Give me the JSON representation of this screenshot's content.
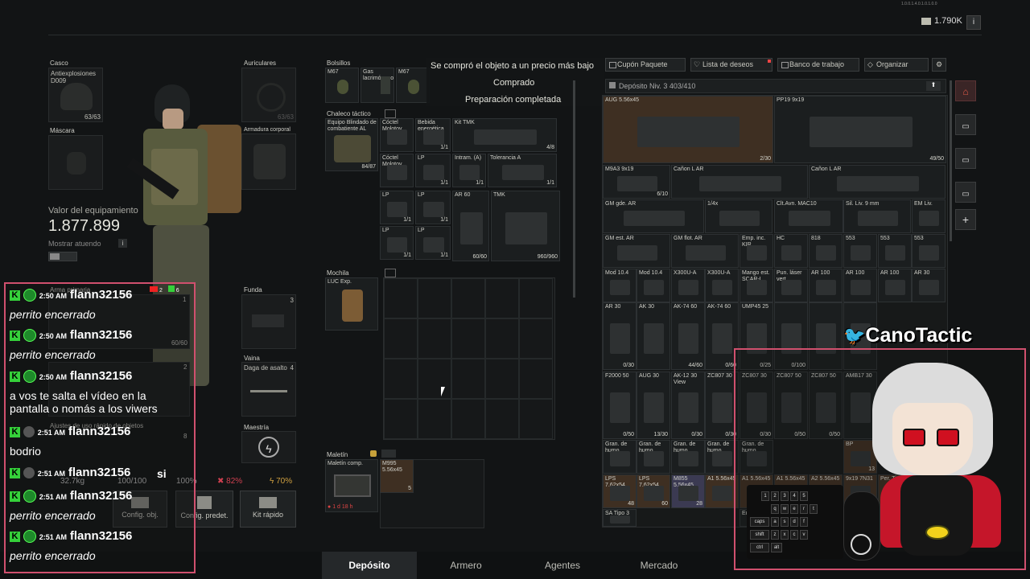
{
  "top_bar": {
    "version_text": "1.0.0.1.4.0.1.0.1.0.0",
    "currency_amount": "1.790K",
    "info_label": "i"
  },
  "notifications": [
    "Se compró el objeto a un precio más bajo",
    "Comprado",
    "Preparación completada"
  ],
  "equipment": {
    "casco_label": "Casco",
    "casco_item": "Antiexplosiones D009",
    "casco_count": "63/63",
    "mascara_label": "Máscara",
    "auriculares_label": "Auriculares",
    "armadura_label": "Armadura corporal",
    "valor_label": "Valor del equipamiento",
    "valor": "1.877.899",
    "mostrar_label": "Mostrar atuendo",
    "arma_primaria_label": "Arma primaria",
    "arma_count": "60/60",
    "funda_label": "Funda",
    "funda_count": "3",
    "vaina_label": "Vaina",
    "vaina_item": "Daga de asalto",
    "vaina_count": "4",
    "maestria_label": "Maestría",
    "ajustes_label": "Ajustes de uso rápido de objetos",
    "slot8_count": "8",
    "slot2_count": "2",
    "slot1_count": "1",
    "weight": "32.7kg",
    "hp": "100/100",
    "stat_100": "100%",
    "stat_82": "82%",
    "stat_70": "70%",
    "btn_config_obj": "Config. obj.",
    "btn_config_predet": "Config. predet.",
    "btn_kit_rapido": "Kit rápido"
  },
  "pockets": {
    "label": "Bolsillos",
    "items": [
      {
        "name": "M67",
        "count": ""
      },
      {
        "name": "Gas lacrimógeno",
        "count": ""
      },
      {
        "name": "M67",
        "count": ""
      }
    ]
  },
  "chaleco": {
    "label": "Chaleco táctico",
    "item": "Equipo Blindado de combatiente AL",
    "item_count": "84/87",
    "cells": [
      {
        "name": "Cóctel Molotov",
        "count": ""
      },
      {
        "name": "Bebida energética",
        "count": "1/1"
      },
      {
        "name": "Kit TMK",
        "count": "4/8"
      },
      {
        "name": "Cóctel Molotov",
        "count": ""
      },
      {
        "name": "LP",
        "count": "1/1"
      },
      {
        "name": "Intram. (A)",
        "count": "1/1"
      },
      {
        "name": "Tolerancia A",
        "count": "1/1"
      },
      {
        "name": "LP",
        "count": "1/1"
      },
      {
        "name": "LP",
        "count": "1/1"
      },
      {
        "name": "AR 60",
        "count": "60/60"
      },
      {
        "name": "TMK",
        "count": "960/960"
      },
      {
        "name": "LP",
        "count": "1/1"
      },
      {
        "name": "LP",
        "count": "1/1"
      },
      {
        "name": "LP",
        "count": "1/1"
      },
      {
        "name": "LP",
        "count": "1/1"
      }
    ]
  },
  "mochila": {
    "label": "Mochila",
    "item": "LUC Exp."
  },
  "maletin": {
    "label": "Maletín",
    "item": "Maletín comp.",
    "time": "1 d 18 h",
    "ammo_name": "M995 5.56x45",
    "ammo_count": "5"
  },
  "stash": {
    "tabs": [
      "Cupón Paquete",
      "Lista de deseos",
      "Banco de trabajo",
      "Organizar"
    ],
    "header": "Depósito Niv. 3  403/410",
    "items": [
      {
        "name": "AUG 5.56x45",
        "count": "2/30"
      },
      {
        "name": "PP19 9x19",
        "count": "49/50"
      },
      {
        "name": "M9A3 9x19",
        "count": "6/10"
      },
      {
        "name": "Cañon L AR",
        "count": ""
      },
      {
        "name": "Cañon L AR",
        "count": ""
      },
      {
        "name": "GM gde. AR",
        "count": ""
      },
      {
        "name": "1/4x",
        "count": ""
      },
      {
        "name": "Clt.Avn. MAC10",
        "count": ""
      },
      {
        "name": "Sil. Liv. 9 mm",
        "count": ""
      },
      {
        "name": "EM Liv.",
        "count": ""
      },
      {
        "name": "GM est. AR",
        "count": ""
      },
      {
        "name": "GM flot. AR",
        "count": ""
      },
      {
        "name": "Emp. inc. KIR",
        "count": ""
      },
      {
        "name": "HC",
        "count": ""
      },
      {
        "name": "818",
        "count": ""
      },
      {
        "name": "553",
        "count": ""
      },
      {
        "name": "553",
        "count": ""
      },
      {
        "name": "553",
        "count": ""
      },
      {
        "name": "Mod 10.4",
        "count": ""
      },
      {
        "name": "Mod 10.4",
        "count": ""
      },
      {
        "name": "X300U-A",
        "count": ""
      },
      {
        "name": "X300U-A",
        "count": ""
      },
      {
        "name": "Mango est. SCAR-L",
        "count": ""
      },
      {
        "name": "Pun. láser vert.",
        "count": ""
      },
      {
        "name": "AR 100",
        "count": ""
      },
      {
        "name": "AR 100",
        "count": ""
      },
      {
        "name": "AR 100",
        "count": ""
      },
      {
        "name": "AR 30",
        "count": ""
      },
      {
        "name": "AR 30",
        "count": "0/30"
      },
      {
        "name": "AK 30",
        "count": ""
      },
      {
        "name": "AK-74 60",
        "count": "44/60"
      },
      {
        "name": "AK-74 60",
        "count": "0/60"
      },
      {
        "name": "UMP45 25",
        "count": "0/25"
      },
      {
        "name": "",
        "count": "0/100"
      },
      {
        "name": "",
        "count": ""
      },
      {
        "name": "",
        "count": ""
      },
      {
        "name": "F2000 50",
        "count": "0/50"
      },
      {
        "name": "AUG 30",
        "count": "13/30"
      },
      {
        "name": "AK-12 30 View",
        "count": "0/30"
      },
      {
        "name": "ZC807 30",
        "count": "0/30"
      },
      {
        "name": "ZC807 30",
        "count": "0/30"
      },
      {
        "name": "ZC807 50",
        "count": "0/50"
      },
      {
        "name": "ZC807 50",
        "count": "0/50"
      },
      {
        "name": "AMB17 30",
        "count": ""
      },
      {
        "name": "Gran. de humo",
        "count": ""
      },
      {
        "name": "Gran. de humo",
        "count": ""
      },
      {
        "name": "Gran. de humo",
        "count": ""
      },
      {
        "name": "Gran. de humo",
        "count": ""
      },
      {
        "name": "Gran. de humo",
        "count": ""
      },
      {
        "name": "BP",
        "count": "13"
      },
      {
        "name": "LPS 7.62x54",
        "count": "48"
      },
      {
        "name": "LPS 7.62x54",
        "count": "60"
      },
      {
        "name": "M855 5.56x45",
        "count": "28"
      },
      {
        "name": "A1 5.56x45",
        "count": ""
      },
      {
        "name": "A1 5.56x45",
        "count": ""
      },
      {
        "name": "A1 5.56x45",
        "count": ""
      },
      {
        "name": "A2 5.56x45",
        "count": ""
      },
      {
        "name": "9x19 7N31",
        "count": ""
      },
      {
        "name": "Per. Tit.",
        "count": ""
      },
      {
        "name": "SA Tipo 3",
        "count": ""
      },
      {
        "name": "Eq",
        "count": ""
      }
    ]
  },
  "bottom_tabs": [
    "Depósito",
    "Armero",
    "Agentes",
    "Mercado"
  ],
  "chat": [
    {
      "time": "2:50 AM",
      "user": "flann32156",
      "msg": "perrito encerrado"
    },
    {
      "time": "2:50 AM",
      "user": "flann32156",
      "msg": "perrito encerrado"
    },
    {
      "time": "2:50 AM",
      "user": "flann32156",
      "msg": "a vos te salta el vídeo en la pantalla o nomás a los viwers"
    },
    {
      "time": "2:51 AM",
      "user": "flann32156",
      "msg": "bodrio"
    },
    {
      "time": "2:51 AM",
      "user": "flann32156",
      "msg": "si"
    },
    {
      "time": "2:51 AM",
      "user": "flann32156",
      "msg": "perrito encerrado"
    },
    {
      "time": "2:51 AM",
      "user": "flann32156",
      "msg": "perrito encerrado"
    }
  ],
  "chat_badges": {
    "yt_count": "2",
    "k_count": "6"
  },
  "streamer": {
    "handle": "CanoTactic"
  },
  "keyboard_keys": [
    "caps",
    "shift",
    "ctrl",
    "alt",
    "q",
    "w",
    "e",
    "r",
    "t",
    "a",
    "s",
    "d",
    "f",
    "z",
    "x",
    "c",
    "v",
    "1",
    "2",
    "3",
    "4",
    "5"
  ],
  "colors": {
    "accent_pink": "#d0506e",
    "twitter_blue": "#1da1f2",
    "kick_green": "#35d13a"
  }
}
